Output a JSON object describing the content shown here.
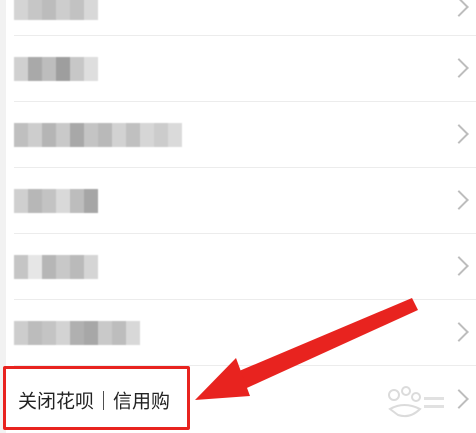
{
  "list": {
    "close_huabei_label": "关闭花呗｜信用购"
  },
  "colors": {
    "highlight": "#e8231f",
    "chevron": "#bdbdbd",
    "divider": "#ececec"
  },
  "icons": {
    "chevron": "chevron-right-icon",
    "arrow": "annotation-arrow-icon"
  }
}
